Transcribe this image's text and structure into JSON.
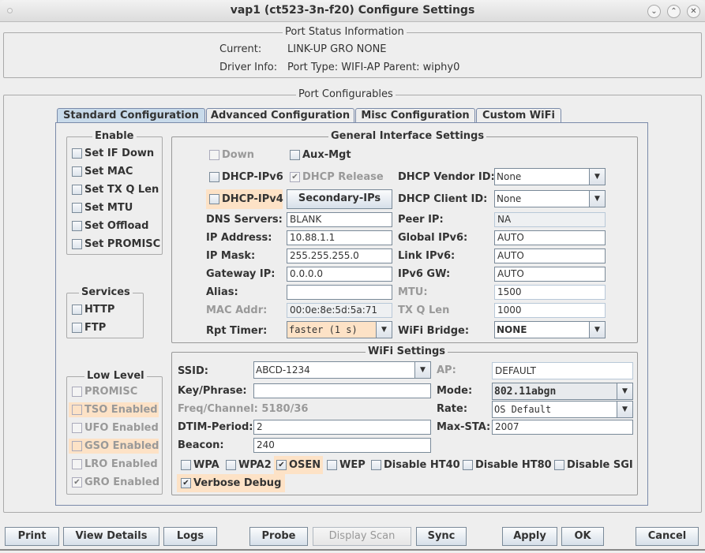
{
  "window": {
    "title": "vap1  (ct523-3n-f20) Configure Settings",
    "controls": [
      "minimize",
      "maximize",
      "close"
    ]
  },
  "status": {
    "title": "Port Status Information",
    "current_label": "Current:",
    "current_value": "LINK-UP GRO  NONE",
    "driver_label": "Driver Info:",
    "driver_value": "Port Type: WIFI-AP   Parent: wiphy0"
  },
  "configurables_title": "Port Configurables",
  "tabs": [
    {
      "label": "Standard Configuration",
      "active": true
    },
    {
      "label": "Advanced Configuration",
      "active": false
    },
    {
      "label": "Misc Configuration",
      "active": false
    },
    {
      "label": "Custom WiFi",
      "active": false
    }
  ],
  "enable": {
    "title": "Enable",
    "items": [
      {
        "label": "Set IF Down",
        "checked": false
      },
      {
        "label": "Set MAC",
        "checked": false
      },
      {
        "label": "Set TX Q Len",
        "checked": false
      },
      {
        "label": "Set MTU",
        "checked": false
      },
      {
        "label": "Set Offload",
        "checked": false
      },
      {
        "label": "Set PROMISC",
        "checked": false
      }
    ]
  },
  "services": {
    "title": "Services",
    "items": [
      {
        "label": "HTTP",
        "checked": false
      },
      {
        "label": "FTP",
        "checked": false
      }
    ]
  },
  "low_level": {
    "title": "Low Level",
    "items": [
      {
        "label": "PROMISC",
        "checked": false
      },
      {
        "label": "TSO Enabled",
        "checked": false
      },
      {
        "label": "UFO Enabled",
        "checked": false
      },
      {
        "label": "GSO Enabled",
        "checked": false
      },
      {
        "label": "LRO Enabled",
        "checked": false
      },
      {
        "label": "GRO Enabled",
        "checked": true
      }
    ]
  },
  "general": {
    "title": "General Interface Settings",
    "down": {
      "label": "Down",
      "checked": false
    },
    "aux_mgt": {
      "label": "Aux-Mgt",
      "checked": false
    },
    "dhcp_ipv6": {
      "label": "DHCP-IPv6",
      "checked": false
    },
    "dhcp_release": {
      "label": "DHCP Release",
      "checked": true
    },
    "dhcp_ipv4": {
      "label": "DHCP-IPv4",
      "checked": false
    },
    "secondary_ips": "Secondary-IPs",
    "dhcp_vendor_id": {
      "label": "DHCP Vendor ID:",
      "value": "None"
    },
    "dhcp_client_id": {
      "label": "DHCP Client ID:",
      "value": "None"
    },
    "dns_servers": {
      "label": "DNS Servers:",
      "value": "BLANK"
    },
    "ip_address": {
      "label": "IP Address:",
      "value": "10.88.1.1"
    },
    "ip_mask": {
      "label": "IP Mask:",
      "value": "255.255.255.0"
    },
    "gateway_ip": {
      "label": "Gateway IP:",
      "value": "0.0.0.0"
    },
    "alias": {
      "label": "Alias:",
      "value": ""
    },
    "mac_addr": {
      "label": "MAC Addr:",
      "value": "00:0e:8e:5d:5a:71"
    },
    "rpt_timer": {
      "label": "Rpt Timer:",
      "value": "faster  (1 s)"
    },
    "peer_ip": {
      "label": "Peer IP:",
      "value": "NA"
    },
    "global_ipv6": {
      "label": "Global IPv6:",
      "value": "AUTO"
    },
    "link_ipv6": {
      "label": "Link IPv6:",
      "value": "AUTO"
    },
    "ipv6_gw": {
      "label": "IPv6 GW:",
      "value": "AUTO"
    },
    "mtu": {
      "label": "MTU:",
      "value": "1500"
    },
    "tx_q_len": {
      "label": "TX Q Len",
      "value": "1000"
    },
    "wifi_bridge": {
      "label": "WiFi Bridge:",
      "value": "NONE"
    }
  },
  "wifi": {
    "title": "WiFi Settings",
    "ssid": {
      "label": "SSID:",
      "value": "ABCD-1234"
    },
    "key": {
      "label": "Key/Phrase:",
      "value": ""
    },
    "freq": "Freq/Channel: 5180/36",
    "dtim": {
      "label": "DTIM-Period:",
      "value": "2"
    },
    "beacon": {
      "label": "Beacon:",
      "value": "240"
    },
    "ap": {
      "label": "AP:",
      "value": "DEFAULT"
    },
    "mode": {
      "label": "Mode:",
      "value": "802.11abgn"
    },
    "rate": {
      "label": "Rate:",
      "value": "OS Default"
    },
    "max_sta": {
      "label": "Max-STA:",
      "value": "2007"
    },
    "flags": [
      {
        "label": "WPA",
        "checked": false
      },
      {
        "label": "WPA2",
        "checked": false
      },
      {
        "label": "OSEN",
        "checked": true
      },
      {
        "label": "WEP",
        "checked": false
      },
      {
        "label": "Disable HT40",
        "checked": false
      },
      {
        "label": "Disable HT80",
        "checked": false
      },
      {
        "label": "Disable SGI",
        "checked": false
      },
      {
        "label": "Verbose Debug",
        "checked": true
      }
    ]
  },
  "buttons": {
    "print": "Print",
    "view_details": "View Details",
    "logs": "Logs",
    "probe": "Probe",
    "display_scan": "Display Scan",
    "sync": "Sync",
    "apply": "Apply",
    "ok": "OK",
    "cancel": "Cancel"
  },
  "check_glyph": "✔"
}
